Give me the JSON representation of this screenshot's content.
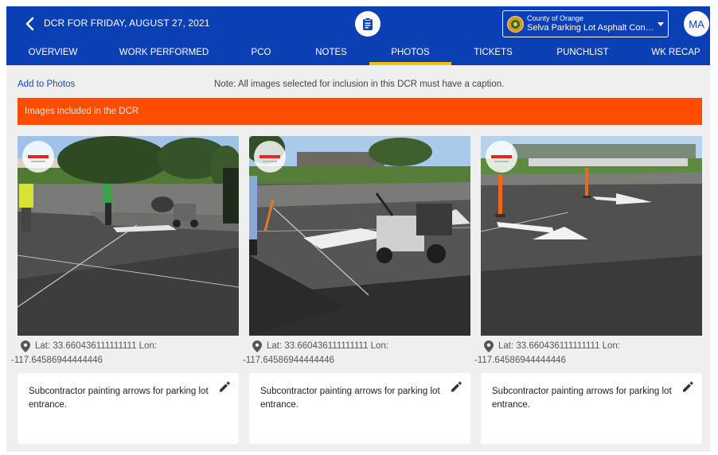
{
  "header": {
    "dcr_title": "DCR FOR FRIDAY, AUGUST 27, 2021",
    "project": {
      "organization": "County of Orange",
      "name": "Selva Parking Lot Asphalt Concrete"
    },
    "user_initials": "MA",
    "icons": {
      "back": "chevron-left-icon",
      "report": "clipboard-icon",
      "dropdown": "caret-down-icon"
    }
  },
  "tabs": [
    {
      "label": "OVERVIEW",
      "active": false
    },
    {
      "label": "WORK PERFORMED",
      "active": false
    },
    {
      "label": "PCO",
      "active": false
    },
    {
      "label": "NOTES",
      "active": false
    },
    {
      "label": "PHOTOS",
      "active": true
    },
    {
      "label": "TICKETS",
      "active": false
    },
    {
      "label": "PUNCHLIST",
      "active": false
    },
    {
      "label": "WK RECAP",
      "active": false
    }
  ],
  "photos_page": {
    "add_link": "Add to Photos",
    "note": "Note: All images selected for inclusion in this DCR must have a caption.",
    "section_title": "Images included in the DCR"
  },
  "photos": [
    {
      "lat_text": "Lat: 33.660436111111111 Lon:",
      "lon_text": "-117.64586944444446",
      "caption": "Subcontractor painting arrows for parking lot entrance."
    },
    {
      "lat_text": "Lat: 33.660436111111111 Lon:",
      "lon_text": "-117.64586944444446",
      "caption": "Subcontractor painting arrows for parking lot entrance."
    },
    {
      "lat_text": "Lat: 33.660436111111111 Lon:",
      "lon_text": "-117.64586944444446",
      "caption": "Subcontractor painting arrows for parking lot entrance."
    }
  ],
  "colors": {
    "primary": "#0b3fb4",
    "tab_indicator": "#f5c400",
    "section_bar": "#ff4d00",
    "page_background": "#efefef"
  }
}
